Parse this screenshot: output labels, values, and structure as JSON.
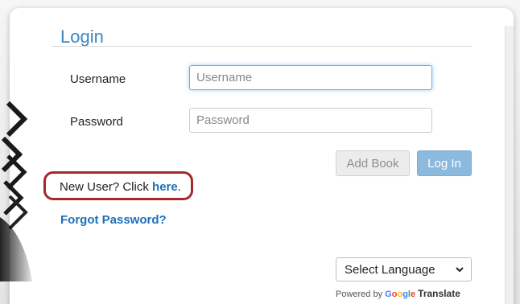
{
  "login": {
    "title": "Login",
    "username_label": "Username",
    "username_placeholder": "Username",
    "username_value": "",
    "password_label": "Password",
    "password_placeholder": "Password",
    "password_value": "",
    "add_book_label": "Add Book",
    "login_label": "Log In"
  },
  "links": {
    "new_user_prefix": "New User? Click ",
    "here_link": "here",
    "new_user_suffix": ".",
    "forgot_password": "Forgot Password?"
  },
  "translate": {
    "select_language": "Select Language",
    "powered_by": "Powered by ",
    "google_g1": "G",
    "google_o1": "o",
    "google_o2": "o",
    "google_g2": "g",
    "google_l": "l",
    "google_e": "e",
    "translate_word": "Translate"
  },
  "colors": {
    "title": "#3a87c8",
    "link": "#1e6fb8",
    "login_button": "#8cb9de",
    "highlight_outline": "#a3292e"
  },
  "icons": {
    "dropdown": "chevron-down-icon"
  }
}
